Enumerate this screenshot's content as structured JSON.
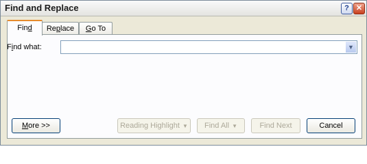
{
  "window": {
    "title": "Find and Replace",
    "help_label": "?",
    "close_label": "✕"
  },
  "tabs": [
    {
      "label_pre": "Fin",
      "label_key": "d",
      "label_post": ""
    },
    {
      "label_pre": "Re",
      "label_key": "p",
      "label_post": "lace"
    },
    {
      "label_pre": "",
      "label_key": "G",
      "label_post": "o To"
    }
  ],
  "find": {
    "label_pre": "F",
    "label_key": "i",
    "label_post": "nd what:",
    "value": "",
    "dropdown_arrow": "▼"
  },
  "buttons": {
    "more_pre": "",
    "more_key": "M",
    "more_post": "ore >>",
    "reading_highlight": "Reading Highlight",
    "find_all": "Find All",
    "dropdown_glyph": "▼",
    "find_next": "Find Next",
    "cancel": "Cancel"
  }
}
